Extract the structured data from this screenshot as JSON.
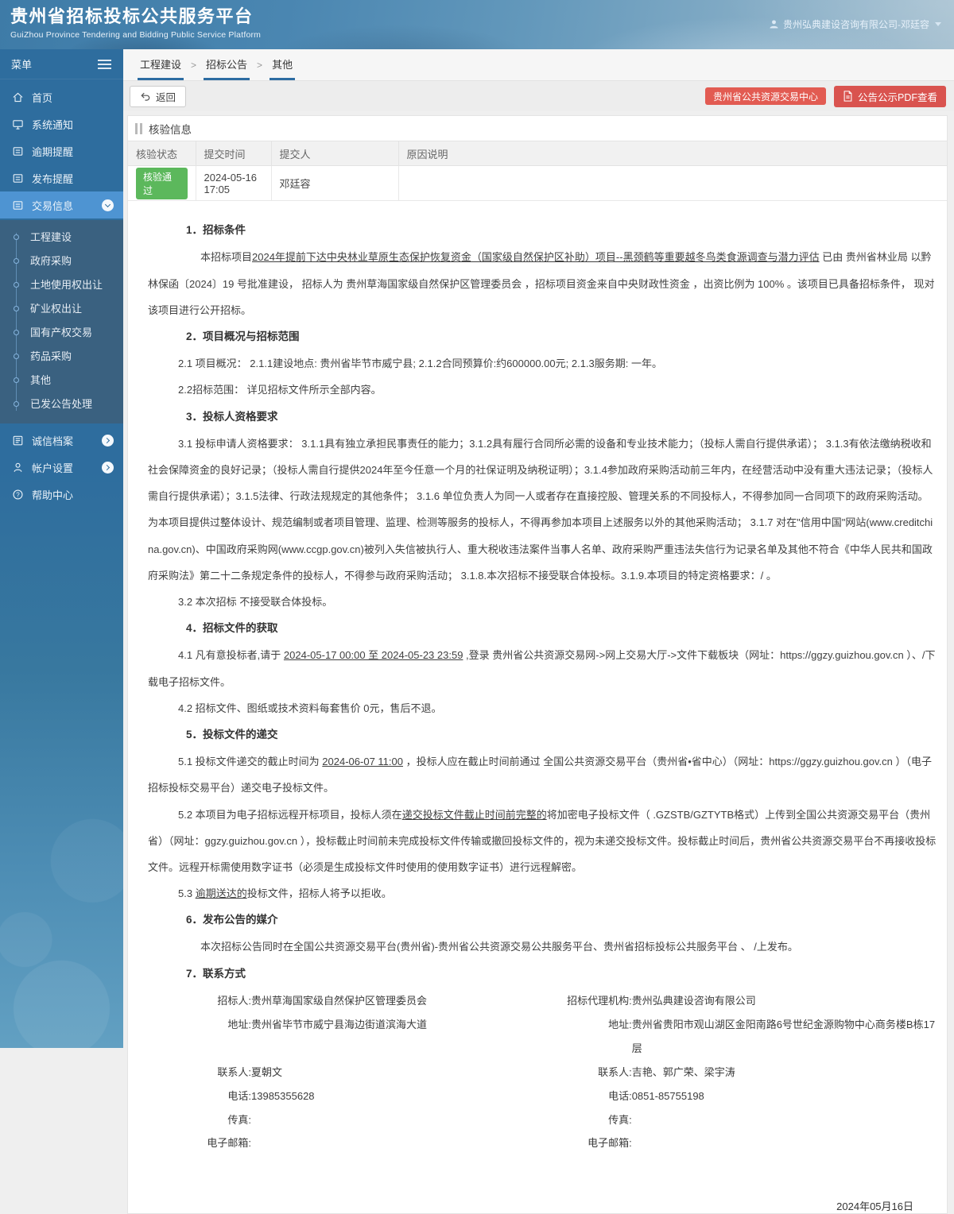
{
  "header": {
    "title": "贵州省招标投标公共服务平台",
    "subtitle": "GuiZhou Province Tendering and Bidding Public Service Platform",
    "user": "贵州弘典建设咨询有限公司-邓廷容",
    "user_icon": "person-icon",
    "accent_colors": {
      "sidebar": "#2e6d9e",
      "selected": "#4e94d2",
      "submenu": "#3a6180",
      "red_button": "#d9534f",
      "green_badge": "#5cb85c",
      "crumb_underline": "#2d6ca2"
    }
  },
  "sidebar": {
    "menu_label": "菜单",
    "menu_icon": "hamburger-icon",
    "items": [
      {
        "id": "home",
        "label": "首页",
        "icon": "home"
      },
      {
        "id": "system-notice",
        "label": "系统通知",
        "icon": "monitor"
      },
      {
        "id": "overdue-reminder",
        "label": "逾期提醒",
        "icon": "card"
      },
      {
        "id": "publish-reminder",
        "label": "发布提醒",
        "icon": "card"
      },
      {
        "id": "trade-info",
        "label": "交易信息",
        "icon": "card",
        "selected": true,
        "expanded": true
      }
    ],
    "submenu": [
      {
        "id": "construction",
        "label": "工程建设"
      },
      {
        "id": "gov-procurement",
        "label": "政府采购"
      },
      {
        "id": "land-use",
        "label": "土地使用权出让"
      },
      {
        "id": "mining-rights",
        "label": "矿业权出让"
      },
      {
        "id": "state-assets",
        "label": "国有产权交易"
      },
      {
        "id": "drug-procurement",
        "label": "药品采购"
      },
      {
        "id": "other",
        "label": "其他"
      },
      {
        "id": "published-notices",
        "label": "已发公告处理"
      }
    ],
    "bottom_items": [
      {
        "id": "credit-archive",
        "label": "诚信档案",
        "icon": "list",
        "chevron": "right"
      },
      {
        "id": "account-settings",
        "label": "帐户设置",
        "icon": "person",
        "chevron": "right"
      },
      {
        "id": "help-center",
        "label": "帮助中心",
        "icon": "question"
      }
    ]
  },
  "breadcrumb": [
    "工程建设",
    "招标公告",
    "其他"
  ],
  "toolbar": {
    "back_label": "返回",
    "back_icon": "undo-arrow-icon",
    "center_button": "贵州省公共资源交易中心",
    "pdf_button": "公告公示PDF查看",
    "pdf_icon": "pdf-document-icon"
  },
  "verify": {
    "section_title": "核验信息",
    "columns": [
      "核验状态",
      "提交时间",
      "提交人",
      "原因说明"
    ],
    "row": {
      "status": "核验通过",
      "time": "2024-05-16 17:05",
      "person": "邓廷容",
      "reason": ""
    }
  },
  "doc": {
    "sections": [
      {
        "heading": "1．招标条件",
        "paras": [
          {
            "ind": 2,
            "runs": [
              {
                "t": "本招标项目"
              },
              {
                "t": "2024年提前下达中央林业草原生态保护恢复资金（国家级自然保护区补助）项目--黑颈鹤等重要越冬鸟类食源调查与潜力评估",
                "u": true
              },
              {
                "t": " 已由 贵州省林业局 以黔林保函〔2024〕19 号批准建设， 招标人为 贵州草海国家级自然保护区管理委员会 ，招标项目资金来自中央财政性资金 ，出资比例为 100% 。该项目已具备招标条件， 现对该项目进行公开招标。"
              }
            ]
          }
        ]
      },
      {
        "heading": "2．项目概况与招标范围",
        "paras": [
          {
            "runs": [
              {
                "t": "2.1 项目概况： 2.1.1建设地点: 贵州省毕节市威宁县; 2.1.2合同预算价:约600000.00元; 2.1.3服务期: 一年。"
              }
            ]
          },
          {
            "runs": [
              {
                "t": "2.2招标范围： 详见招标文件所示全部内容。"
              }
            ]
          }
        ]
      },
      {
        "heading": "3．投标人资格要求",
        "paras": [
          {
            "runs": [
              {
                "t": "3.1 投标申请人资格要求： 3.1.1具有独立承担民事责任的能力；3.1.2具有履行合同所必需的设备和专业技术能力；（投标人需自行提供承诺）； 3.1.3有依法缴纳税收和社会保障资金的良好记录；（投标人需自行提供2024年至今任意一个月的社保证明及纳税证明）；3.1.4参加政府采购活动前三年内，在经营活动中没有重大违法记录；（投标人需自行提供承诺）；3.1.5法律、行政法规规定的其他条件； 3.1.6 单位负责人为同一人或者存在直接控股、管理关系的不同投标人，不得参加同一合同项下的政府采购活动。为本项目提供过整体设计、规范编制或者项目管理、监理、检测等服务的投标人，不得再参加本项目上述服务以外的其他采购活动； 3.1.7 对在\"信用中国\"网站(www.creditchina.gov.cn)、中国政府采购网(www.ccgp.gov.cn)被列入失信被执行人、重大税收违法案件当事人名单、政府采购严重违法失信行为记录名单及其他不符合《中华人民共和国政府采购法》第二十二条规定条件的投标人，不得参与政府采购活动； 3.1.8.本次招标不接受联合体投标。3.1.9.本项目的特定资格要求：/ 。"
              }
            ]
          },
          {
            "runs": [
              {
                "t": "3.2 本次招标 不接受联合体投标。"
              }
            ]
          }
        ]
      },
      {
        "heading": "4．招标文件的获取",
        "paras": [
          {
            "runs": [
              {
                "t": "4.1 凡有意投标者,请于 "
              },
              {
                "t": "2024-05-17 00:00 至 2024-05-23 23:59",
                "u": true
              },
              {
                "t": " ,登录 贵州省公共资源交易网->网上交易大厅->文件下载板块（网址：https://ggzy.guizhou.gov.cn ）、/下载电子招标文件。"
              }
            ]
          },
          {
            "runs": [
              {
                "t": "4.2 招标文件、图纸或技术资料每套售价 0元，售后不退。"
              }
            ]
          }
        ]
      },
      {
        "heading": "5．投标文件的递交",
        "paras": [
          {
            "runs": [
              {
                "t": "5.1 投标文件递交的截止时间为 "
              },
              {
                "t": "2024-06-07 11:00",
                "u": true
              },
              {
                "t": " ，投标人应在截止时间前通过 全国公共资源交易平台（贵州省•省中心）（网址：https://ggzy.guizhou.gov.cn ）（电子招标投标交易平台）递交电子投标文件。"
              }
            ]
          },
          {
            "runs": [
              {
                "t": "5.2 本项目为电子招标远程开标项目，投标人须在"
              },
              {
                "t": "递交投标文件截止时间前完整的",
                "u": true
              },
              {
                "t": "将加密电子投标文件（ .GZSTB/GZTYTB格式）上传到全国公共资源交易平台（贵州省）（网址：ggzy.guizhou.gov.cn ），投标截止时间前未完成投标文件传输或撤回投标文件的，视为未递交投标文件。投标截止时间后，贵州省公共资源交易平台不再接收投标文件。远程开标需使用数字证书（必须是生成投标文件时使用的使用数字证书）进行远程解密。"
              }
            ]
          },
          {
            "runs": [
              {
                "t": "5.3 "
              },
              {
                "t": "逾期送达的",
                "u": true
              },
              {
                "t": "投标文件，招标人将予以拒收。"
              }
            ]
          }
        ]
      },
      {
        "heading": "6．发布公告的媒介",
        "paras": [
          {
            "ind": 2,
            "runs": [
              {
                "t": "本次招标公告同时在全国公共资源交易平台(贵州省)-贵州省公共资源交易公共服务平台、贵州省招标投标公共服务平台 、 /上发布。"
              }
            ]
          }
        ]
      },
      {
        "heading": "7．联系方式",
        "paras": []
      }
    ],
    "contacts": {
      "left": [
        {
          "label": "招标人:",
          "value": "贵州草海国家级自然保护区管理委员会"
        },
        {
          "label": "地址:",
          "value": "贵州省毕节市威宁县海边街道滨海大道"
        },
        {
          "label": "联系人:",
          "value": "夏朝文"
        },
        {
          "label": "电话:",
          "value": "13985355628"
        },
        {
          "label": "传真:",
          "value": ""
        },
        {
          "label": "电子邮箱:",
          "value": ""
        }
      ],
      "right": [
        {
          "label": "招标代理机构:",
          "value": "贵州弘典建设咨询有限公司"
        },
        {
          "label": "地址:",
          "value": "贵州省贵阳市观山湖区金阳南路6号世纪金源购物中心商务楼B栋17层"
        },
        {
          "label": "联系人:",
          "value": "吉艳、郭广荣、梁宇涛"
        },
        {
          "label": "电话:",
          "value": "0851-85755198"
        },
        {
          "label": "传真:",
          "value": ""
        },
        {
          "label": "电子邮箱:",
          "value": ""
        }
      ]
    },
    "date": "2024年05月16日"
  }
}
